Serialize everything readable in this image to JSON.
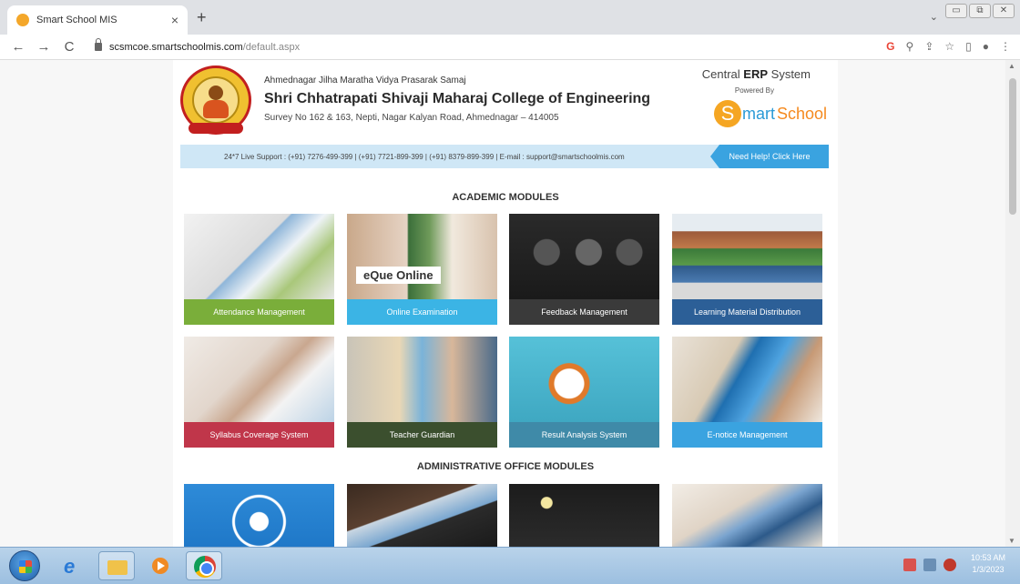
{
  "browser": {
    "tab_title": "Smart School MIS",
    "tab_close": "×",
    "new_tab": "+",
    "url_host": "scsmcoe.smartschoolmis.com",
    "url_path": "/default.aspx",
    "back": "←",
    "forward": "→",
    "reload": "C",
    "dropdown": "⌄",
    "window_buttons": [
      "▭",
      "⧉",
      "✕"
    ],
    "addr_icons": [
      "G",
      "⚲",
      "⇪",
      "☆",
      "▯",
      "●",
      "⋮"
    ]
  },
  "header": {
    "society": "Ahmednagar Jilha Maratha Vidya Prasarak Samaj",
    "college": "Shri Chhatrapati Shivaji Maharaj College of Engineering",
    "address": "Survey No 162 & 163, Nepti, Nagar Kalyan Road, Ahmednagar – 414005",
    "erp_prefix": "Central ",
    "erp_bold": "ERP",
    "erp_suffix": " System",
    "powered_by": "Powered By",
    "brand_s": "S",
    "brand_mid": "mart",
    "brand_end": "School"
  },
  "support": {
    "text": "24*7 Live Support : (+91) 7276-499-399 | (+91) 7721-899-399 | (+91) 8379-899-399 | E-mail : support@smartschoolmis.com",
    "help_button": "Need Help! Click Here"
  },
  "sections": {
    "academic": "ACADEMIC MODULES",
    "administrative": "ADMINISTRATIVE OFFICE MODULES"
  },
  "academic_modules": [
    {
      "label": "Attendance Management",
      "color": "#7aae3a"
    },
    {
      "label": "Online Examination",
      "color": "#3bb4e5",
      "overlay": "eQue Online"
    },
    {
      "label": "Feedback Management",
      "color": "#3a3a3a"
    },
    {
      "label": "Learning Material Distribution",
      "color": "#2c5f97"
    },
    {
      "label": "Syllabus Coverage System",
      "color": "#c0364a"
    },
    {
      "label": "Teacher Guardian",
      "color": "#3b4f2e"
    },
    {
      "label": "Result Analysis System",
      "color": "#3f8aa8"
    },
    {
      "label": "E-notice Management",
      "color": "#3aa3e0"
    }
  ],
  "taskbar": {
    "time": "10:53 AM",
    "date": "1/3/2023"
  }
}
